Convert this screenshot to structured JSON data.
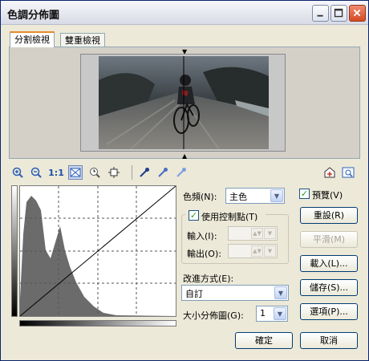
{
  "window": {
    "title": "色調分佈圖"
  },
  "tabs": [
    {
      "label": "分割檢視",
      "active": true
    },
    {
      "label": "雙重檢視",
      "active": false
    }
  ],
  "preview": {
    "marker_top": "▼",
    "marker_bottom": "▲"
  },
  "toolbar": {
    "zoom_in_icon": "zoom-in-icon",
    "zoom_out_icon": "zoom-out-icon",
    "actual_size_label": "1:1",
    "fit_icon": "fit-window-icon",
    "zoom_tool_icon": "zoom-tool-icon",
    "pan_icon": "pan-icon",
    "eyedropper_icons": [
      "black-point-eyedropper-icon",
      "gray-point-eyedropper-icon",
      "white-point-eyedropper-icon"
    ],
    "right_icons": [
      "import-icon",
      "preview-window-icon"
    ]
  },
  "channel": {
    "label": "色頻(N):",
    "value": "主色"
  },
  "preview_checkbox": {
    "label": "預覽(V)",
    "checked": true
  },
  "control_points": {
    "label": "使用控制點(T)",
    "checked": true,
    "input_label": "輸入(I):",
    "output_label": "輸出(O):",
    "input_value": "",
    "output_value": ""
  },
  "method": {
    "label": "改進方式(E):",
    "value": "自訂"
  },
  "size": {
    "label": "大小分佈圖(G):",
    "value": "1"
  },
  "buttons": {
    "reset": "重設(R)",
    "smooth": "平滑(M)",
    "load": "載入(L)...",
    "save": "儲存(S)...",
    "options": "選項(P)...",
    "ok": "確定",
    "cancel": "取消"
  },
  "colors": {
    "titlebar_accent": "#0a246a",
    "tab_accent": "#e68b2c",
    "close_button": "#d44a24"
  }
}
